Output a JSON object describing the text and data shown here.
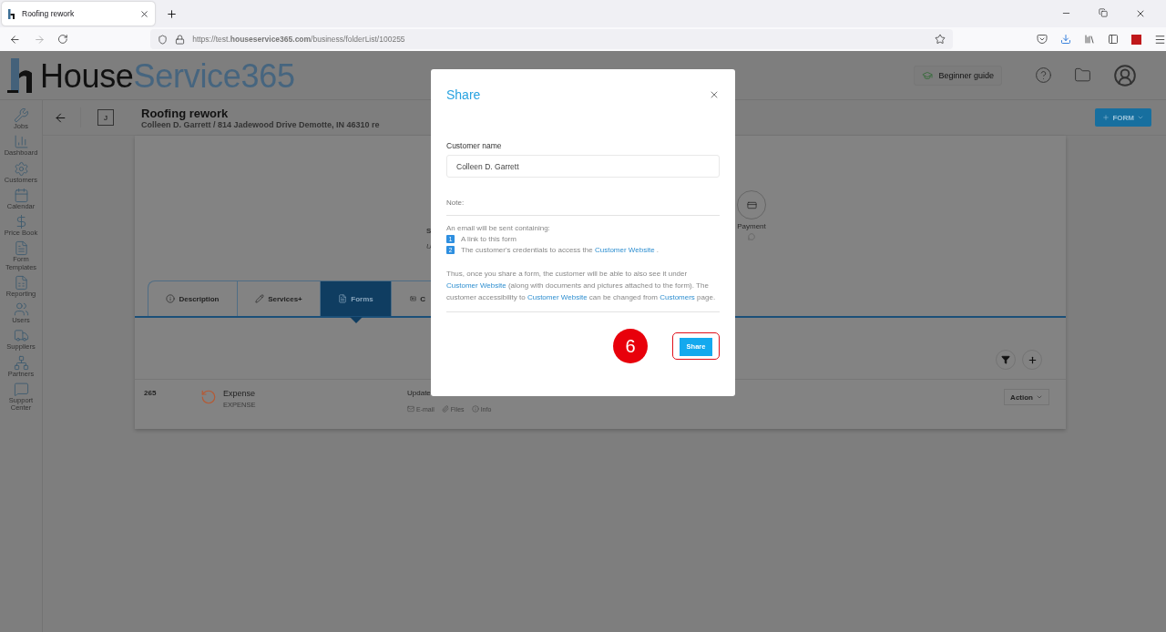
{
  "browser": {
    "tab_title": "Roofing rework",
    "url": "https://test.**houseservice365.com**/business/folderList/100255"
  },
  "header": {
    "logo": {
      "text_1": "House",
      "text_2": "Service365"
    },
    "guide_button": "Beginner guide"
  },
  "sidebar": {
    "items": [
      {
        "kind": "jobs",
        "label": "Jobs"
      },
      {
        "kind": "dashboard",
        "label": "Dashboard"
      },
      {
        "kind": "customers",
        "label": "Customers"
      },
      {
        "kind": "calendar",
        "label": "Calendar"
      },
      {
        "kind": "pricebook",
        "label": "Price Book"
      },
      {
        "kind": "templates",
        "label": "Form Templates"
      },
      {
        "kind": "reporting",
        "label": "Reporting"
      },
      {
        "kind": "users",
        "label": "Users"
      },
      {
        "kind": "suppliers",
        "label": "Suppliers"
      },
      {
        "kind": "partners",
        "label": "Partners"
      },
      {
        "kind": "support",
        "label": "Support Center"
      }
    ]
  },
  "job": {
    "badge": "J",
    "title": "Roofing rework",
    "subtitle": "Colleen D. Garrett / 814 Jadewood Drive Demotte, IN 46310 re",
    "form_button": "FORM"
  },
  "steps": {
    "fragment_1": "S",
    "fragment_2": "U",
    "payment_label": "Payment"
  },
  "tabs": [
    {
      "kind": "info",
      "label": "Description",
      "selected": false
    },
    {
      "kind": "pencil",
      "label": "Services+",
      "selected": false
    },
    {
      "kind": "file",
      "label": "Forms",
      "selected": true
    },
    {
      "kind": "card",
      "label": "C",
      "selected": false
    }
  ],
  "forms": [
    {
      "number": "265",
      "name": "Expense",
      "type": "EXPENSE",
      "updated": "Update",
      "links": [
        {
          "kind": "email",
          "label": "E-mail"
        },
        {
          "kind": "files",
          "label": "Files"
        },
        {
          "kind": "info",
          "label": "Info"
        }
      ],
      "action": "Action"
    }
  ],
  "dialog": {
    "title": "Share",
    "customer_label": "Customer name",
    "customer_value": "Colleen D. Garrett",
    "note_label": "Note:",
    "intro": "An email will be sent containing:",
    "items": [
      {
        "number": "1",
        "segments": [
          {
            "text": "A link to this form",
            "link": false
          }
        ]
      },
      {
        "number": "2",
        "segments": [
          {
            "text": "The customer's credentials to access the ",
            "link": false
          },
          {
            "text": "Customer Website",
            "link": true
          },
          {
            "text": " .",
            "link": false
          }
        ]
      }
    ],
    "paragraph": [
      {
        "text": "Thus, once you share a form, the customer will be able to also see it under ",
        "link": false
      },
      {
        "text": "Customer Website",
        "link": true
      },
      {
        "text": " (along with documents and pictures attached to the form). The customer accessibility to ",
        "link": false
      },
      {
        "text": "Customer Website",
        "link": true
      },
      {
        "text": " can be changed from ",
        "link": false
      },
      {
        "text": "Customers",
        "link": true
      },
      {
        "text": " page.",
        "link": false
      }
    ],
    "share_button": "Share",
    "callout": "6"
  }
}
